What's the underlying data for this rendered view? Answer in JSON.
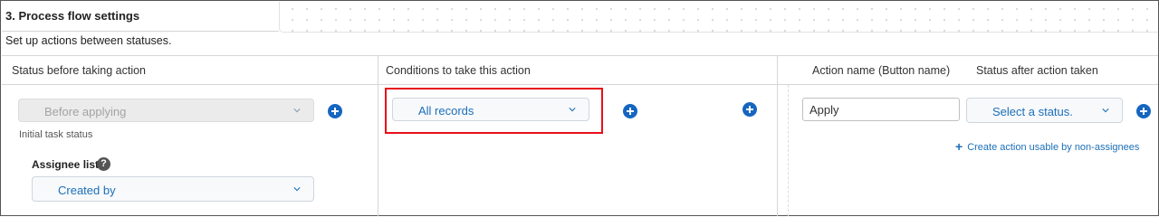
{
  "section": {
    "title": "3. Process flow settings",
    "description": "Set up actions between statuses."
  },
  "table": {
    "headers": {
      "status_before": "Status before taking action",
      "conditions": "Conditions to take this action",
      "action_name": "Action name (Button name)",
      "status_after": "Status after action taken"
    }
  },
  "status_before": {
    "select_value": "Before applying",
    "disabled": true,
    "note": "Initial task status",
    "assignee_label": "Assignee list",
    "help_glyph": "?",
    "assignee_value": "Created by"
  },
  "conditions": {
    "select_value": "All records",
    "highlight_color": "#e8101a"
  },
  "action": {
    "name_value": "Apply",
    "status_after_placeholder": "Select a status.",
    "create_link": "Create action usable by non-assignees",
    "link_icon": "+"
  },
  "colors": {
    "accent": "#1566c0",
    "link": "#1d6fb8"
  },
  "icons": [
    "chevron-down-icon",
    "plus-circle-icon",
    "help-icon"
  ]
}
